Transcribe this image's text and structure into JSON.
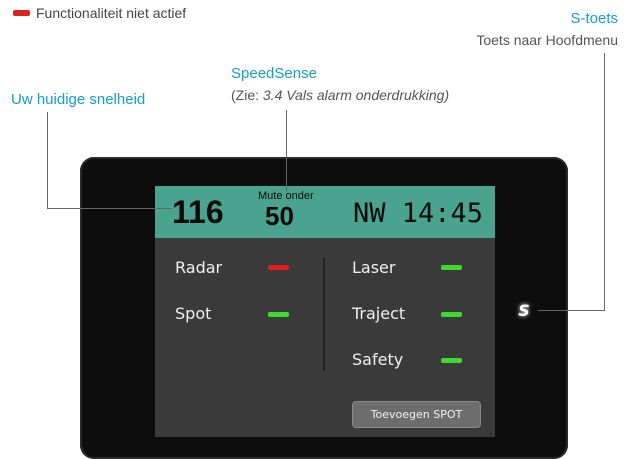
{
  "legend": {
    "inactive_label": "Functionaliteit niet actief",
    "inactive_color": "#e0201e"
  },
  "annotations": {
    "s_key_title": "S-toets",
    "s_key_desc": "Toets naar Hoofdmenu",
    "speedsense_title": "SpeedSense",
    "speedsense_ref_prefix": "(Zie: ",
    "speedsense_ref_italic": "3.4 Vals alarm onderdrukking)",
    "current_speed": "Uw huidige snelheid"
  },
  "screen": {
    "speed": "116",
    "mute_label": "Mute onder",
    "mute_value": "50",
    "direction_time": "NW 14:45",
    "alerts": [
      {
        "label": "Radar",
        "status": "inactive"
      },
      {
        "label": "Spot",
        "status": "active"
      },
      {
        "label": "Laser",
        "status": "active"
      },
      {
        "label": "Traject",
        "status": "active"
      },
      {
        "label": "Safety",
        "status": "active"
      }
    ],
    "add_spot_button": "Toevoegen SPOT"
  },
  "device": {
    "s_key_glyph": "S"
  },
  "colors": {
    "accent": "#14a0c8",
    "topbar": "#4aa38f",
    "active": "#3bdc2e",
    "inactive": "#e11f1f"
  }
}
